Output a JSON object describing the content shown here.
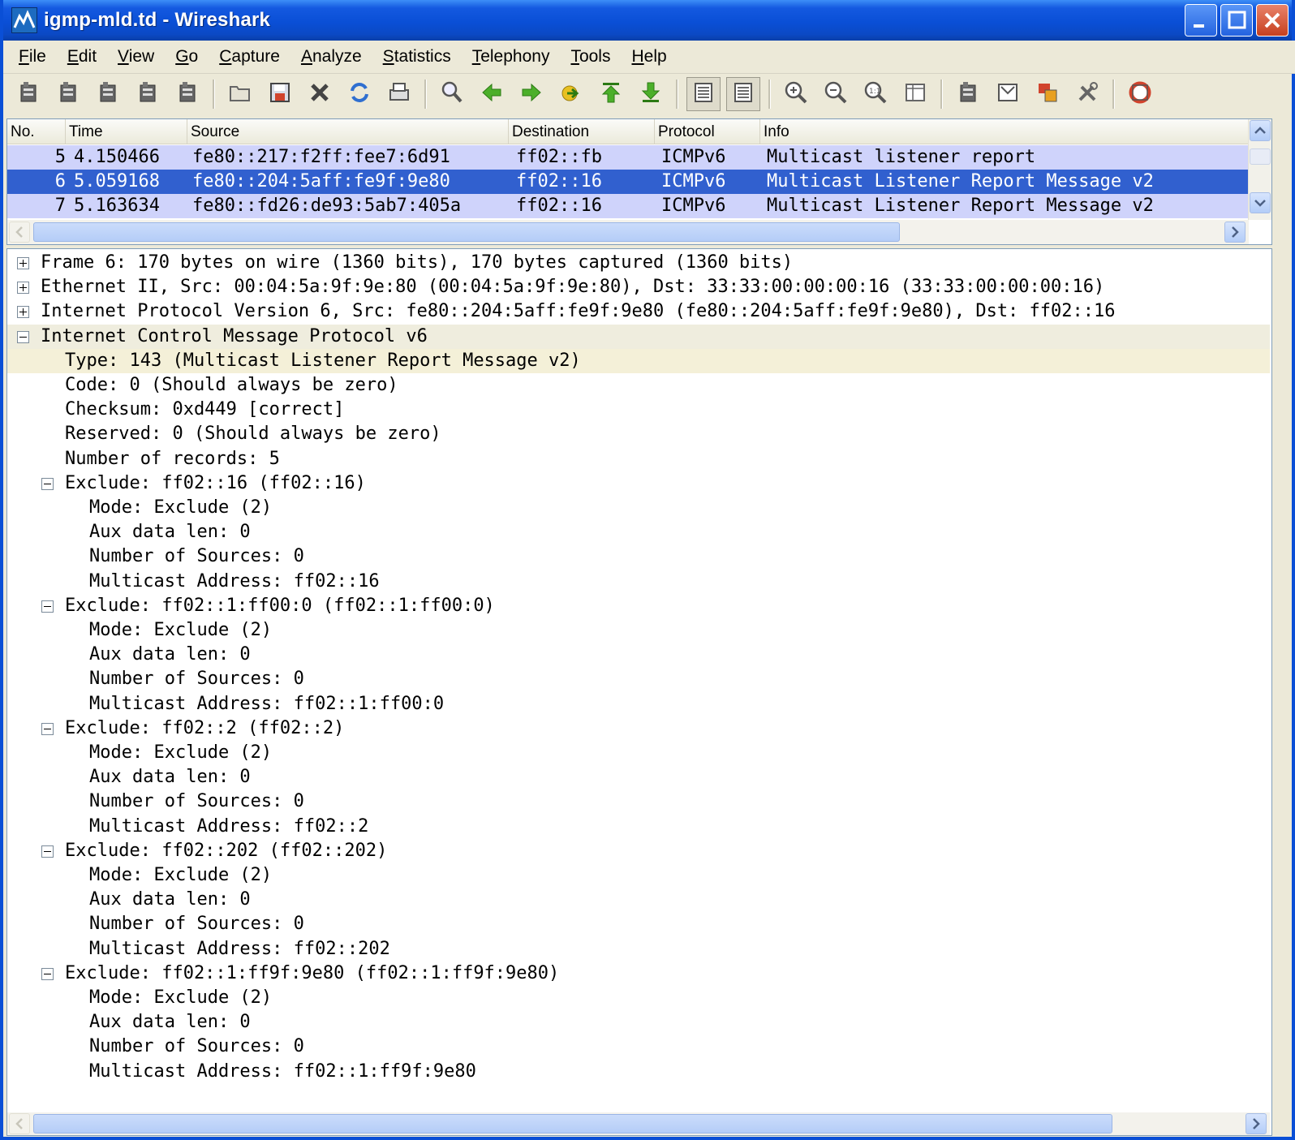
{
  "window": {
    "title": "igmp-mld.td - Wireshark"
  },
  "menu": {
    "items": [
      {
        "label": "File"
      },
      {
        "label": "Edit"
      },
      {
        "label": "View"
      },
      {
        "label": "Go"
      },
      {
        "label": "Capture"
      },
      {
        "label": "Analyze"
      },
      {
        "label": "Statistics"
      },
      {
        "label": "Telephony"
      },
      {
        "label": "Tools"
      },
      {
        "label": "Help"
      }
    ]
  },
  "toolbar": {
    "icons": [
      "interface-list-icon",
      "capture-options-icon",
      "capture-start-icon",
      "capture-stop-icon",
      "capture-restart-icon",
      "open-file-icon",
      "save-file-icon",
      "close-file-icon",
      "reload-icon",
      "print-icon",
      "find-icon",
      "go-back-icon",
      "go-forward-icon",
      "go-to-packet-icon",
      "go-first-icon",
      "go-last-icon",
      "colorize-icon",
      "auto-scroll-icon",
      "zoom-in-icon",
      "zoom-out-icon",
      "zoom-normal-icon",
      "resize-columns-icon",
      "capture-filters-icon",
      "display-filters-icon",
      "coloring-rules-icon",
      "preferences-icon",
      "help-icon"
    ]
  },
  "packet_list": {
    "columns": [
      "No.",
      "Time",
      "Source",
      "Destination",
      "Protocol",
      "Info"
    ],
    "rows": [
      {
        "no": "5",
        "time": "4.150466",
        "source": "fe80::217:f2ff:fee7:6d91",
        "destination": "ff02::fb",
        "protocol": "ICMPv6",
        "info": "Multicast listener report",
        "selected": false
      },
      {
        "no": "6",
        "time": "5.059168",
        "source": "fe80::204:5aff:fe9f:9e80",
        "destination": "ff02::16",
        "protocol": "ICMPv6",
        "info": "Multicast Listener Report Message v2",
        "selected": true
      },
      {
        "no": "7",
        "time": "5.163634",
        "source": "fe80::fd26:de93:5ab7:405a",
        "destination": "ff02::16",
        "protocol": "ICMPv6",
        "info": "Multicast Listener Report Message v2",
        "selected": false
      }
    ]
  },
  "details": {
    "lines": [
      {
        "text": "Frame 6: 170 bytes on wire (1360 bits), 170 bytes captured (1360 bits)",
        "toggle": "plus"
      },
      {
        "text": "Ethernet II, Src: 00:04:5a:9f:9e:80 (00:04:5a:9f:9e:80), Dst: 33:33:00:00:00:16 (33:33:00:00:00:16)",
        "toggle": "plus"
      },
      {
        "text": "Internet Protocol Version 6, Src: fe80::204:5aff:fe9f:9e80 (fe80::204:5aff:fe9f:9e80), Dst: ff02::16",
        "toggle": "plus"
      },
      {
        "text": "Internet Control Message Protocol v6",
        "toggle": "minus"
      },
      {
        "text": "Type: 143 (Multicast Listener Report Message v2)",
        "toggle": ""
      },
      {
        "text": "Code: 0 (Should always be zero)",
        "toggle": ""
      },
      {
        "text": "Checksum: 0xd449 [correct]",
        "toggle": ""
      },
      {
        "text": "Reserved: 0 (Should always be zero)",
        "toggle": ""
      },
      {
        "text": "Number of records: 5",
        "toggle": ""
      },
      {
        "text": "Exclude: ff02::16 (ff02::16)",
        "toggle": "minus"
      },
      {
        "text": "Mode: Exclude (2)",
        "toggle": ""
      },
      {
        "text": "Aux data len: 0",
        "toggle": ""
      },
      {
        "text": "Number of Sources: 0",
        "toggle": ""
      },
      {
        "text": "Multicast Address: ff02::16",
        "toggle": ""
      },
      {
        "text": "Exclude: ff02::1:ff00:0 (ff02::1:ff00:0)",
        "toggle": "minus"
      },
      {
        "text": "Mode: Exclude (2)",
        "toggle": ""
      },
      {
        "text": "Aux data len: 0",
        "toggle": ""
      },
      {
        "text": "Number of Sources: 0",
        "toggle": ""
      },
      {
        "text": "Multicast Address: ff02::1:ff00:0",
        "toggle": ""
      },
      {
        "text": "Exclude: ff02::2 (ff02::2)",
        "toggle": "minus"
      },
      {
        "text": "Mode: Exclude (2)",
        "toggle": ""
      },
      {
        "text": "Aux data len: 0",
        "toggle": ""
      },
      {
        "text": "Number of Sources: 0",
        "toggle": ""
      },
      {
        "text": "Multicast Address: ff02::2",
        "toggle": ""
      },
      {
        "text": "Exclude: ff02::202 (ff02::202)",
        "toggle": "minus"
      },
      {
        "text": "Mode: Exclude (2)",
        "toggle": ""
      },
      {
        "text": "Aux data len: 0",
        "toggle": ""
      },
      {
        "text": "Number of Sources: 0",
        "toggle": ""
      },
      {
        "text": "Multicast Address: ff02::202",
        "toggle": ""
      },
      {
        "text": "Exclude: ff02::1:ff9f:9e80 (ff02::1:ff9f:9e80)",
        "toggle": "minus"
      },
      {
        "text": "Mode: Exclude (2)",
        "toggle": ""
      },
      {
        "text": "Aux data len: 0",
        "toggle": ""
      },
      {
        "text": "Number of Sources: 0",
        "toggle": ""
      },
      {
        "text": "Multicast Address: ff02::1:ff9f:9e80",
        "toggle": ""
      }
    ]
  },
  "colors": {
    "selected_row": "#3160cf",
    "row_highlight": "#cfd3fb",
    "titlebar": "#0a4fd6"
  }
}
